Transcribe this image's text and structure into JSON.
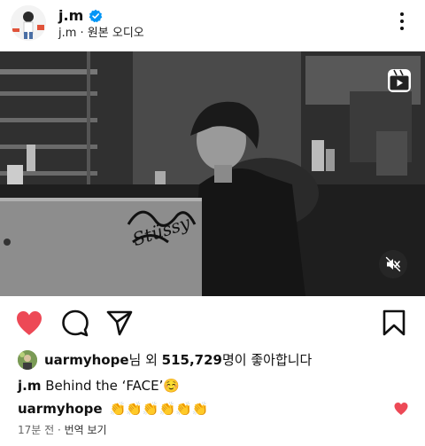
{
  "header": {
    "username": "j.m",
    "audio_label": "j.m · 원본 오디오",
    "avatar_icon": "profile-photo",
    "verified_icon": "verified-badge-icon",
    "more_icon": "more-vertical-icon"
  },
  "media": {
    "type_icon": "reels-icon",
    "sound_icon": "muted-speaker-icon",
    "laptop_sticker_text": "Stüssy"
  },
  "actions": {
    "like_icon": "heart-filled-icon",
    "comment_icon": "comment-icon",
    "share_icon": "send-icon",
    "save_icon": "bookmark-icon",
    "like_color": "#ed4956"
  },
  "likes": {
    "liker": "uarmyhope",
    "mid_text": "님 외 ",
    "count": "515,729",
    "suffix": "명이 좋아합니다"
  },
  "caption": {
    "author": "j.m",
    "text": "Behind the ‘FACE’☺️"
  },
  "comment": {
    "author": "uarmyhope",
    "text": "👏👏👏👏👏👏"
  },
  "meta": {
    "time": "17분 전",
    "separator": " · ",
    "translate": "번역 보기"
  }
}
